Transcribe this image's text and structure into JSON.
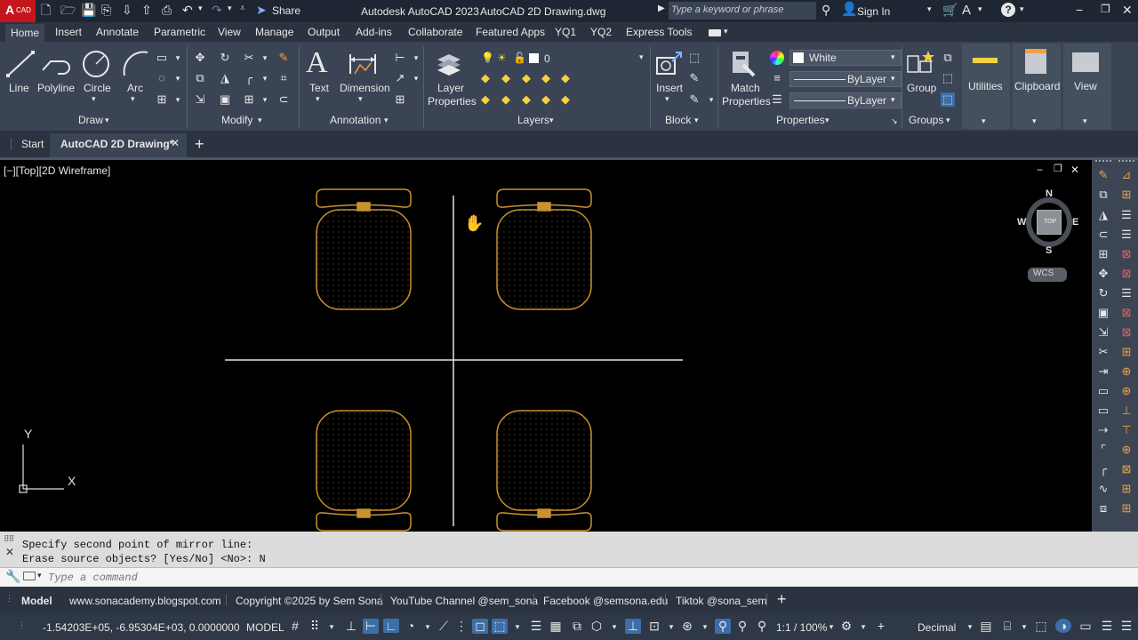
{
  "titlebar": {
    "app_badge": "A",
    "app_badge_sub": "CAD",
    "share": "Share",
    "app_title": "Autodesk AutoCAD 2023",
    "file_title": "AutoCAD 2D Drawing.dwg",
    "search_placeholder": "Type a keyword or phrase",
    "sign_in": "Sign In"
  },
  "ribbon_tabs": [
    "Home",
    "Insert",
    "Annotate",
    "Parametric",
    "View",
    "Manage",
    "Output",
    "Add-ins",
    "Collaborate",
    "Featured Apps",
    "YQ1",
    "YQ2",
    "Express Tools"
  ],
  "ribbon": {
    "draw": {
      "title": "Draw",
      "line": "Line",
      "polyline": "Polyline",
      "circle": "Circle",
      "arc": "Arc"
    },
    "modify": {
      "title": "Modify"
    },
    "annotation": {
      "title": "Annotation",
      "text": "Text",
      "dimension": "Dimension"
    },
    "layers": {
      "title": "Layers",
      "layer_properties_1": "Layer",
      "layer_properties_2": "Properties",
      "current_layer": "0"
    },
    "block": {
      "title": "Block",
      "insert": "Insert"
    },
    "properties": {
      "title": "Properties",
      "match_1": "Match",
      "match_2": "Properties",
      "color": "White",
      "linetype": "ByLayer",
      "lineweight": "ByLayer"
    },
    "groups": {
      "title": "Groups",
      "group": "Group"
    },
    "utilities": "Utilities",
    "clipboard": "Clipboard",
    "view": "View"
  },
  "doc_tabs": {
    "start": "Start",
    "active": "AutoCAD 2D Drawing*"
  },
  "viewport": {
    "label": "[−][Top][2D Wireframe]",
    "compass_n": "N",
    "compass_s": "S",
    "compass_e": "E",
    "compass_w": "W",
    "compass_top": "TOP",
    "wcs": "WCS",
    "ucs_x": "X",
    "ucs_y": "Y"
  },
  "command": {
    "history_1": "Specify second point of mirror line:",
    "history_2": "Erase source objects? [Yes/No] <No>: N",
    "placeholder": "Type a command"
  },
  "layout_tabs": [
    "Model",
    "www.sonacademy.blogspot.com",
    "Copyright ©2025 by Sem Sona",
    "YouTube Channel @sem_sona",
    "Facebook @semsona.edu",
    "Tiktok @sona_sem"
  ],
  "status": {
    "coords": "-1.54203E+05, -6.95304E+03, 0.0000000",
    "model": "MODEL",
    "scale": "1:1 / 100%",
    "units": "Decimal"
  },
  "colors": {
    "chair_outline": "#c8922e",
    "accent": "#3c6ea8"
  }
}
